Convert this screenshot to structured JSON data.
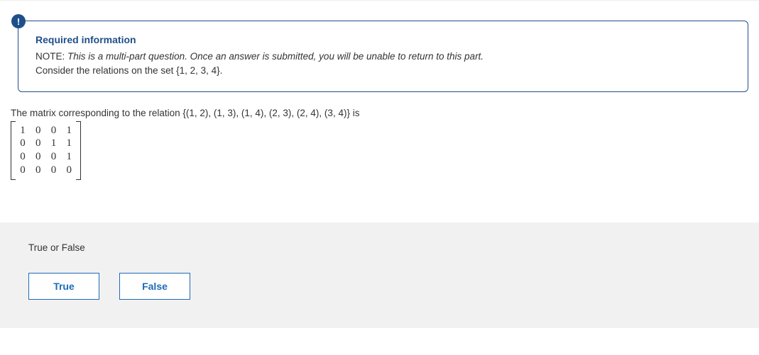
{
  "info": {
    "badge": "!",
    "title": "Required information",
    "note_label": "NOTE:",
    "note_italic": "This is a multi-part question. Once an answer is submitted, you will be unable to return to this part.",
    "context": "Consider the relations on the set {1, 2, 3, 4}."
  },
  "question": {
    "stem": "The matrix corresponding to the relation {(1, 2), (1, 3), (1, 4), (2, 3), (2, 4), (3, 4)} is",
    "matrix": [
      [
        "1",
        "0",
        "0",
        "1"
      ],
      [
        "0",
        "0",
        "1",
        "1"
      ],
      [
        "0",
        "0",
        "0",
        "1"
      ],
      [
        "0",
        "0",
        "0",
        "0"
      ]
    ]
  },
  "answer": {
    "prompt": "True or False",
    "options": {
      "true_label": "True",
      "false_label": "False"
    }
  }
}
